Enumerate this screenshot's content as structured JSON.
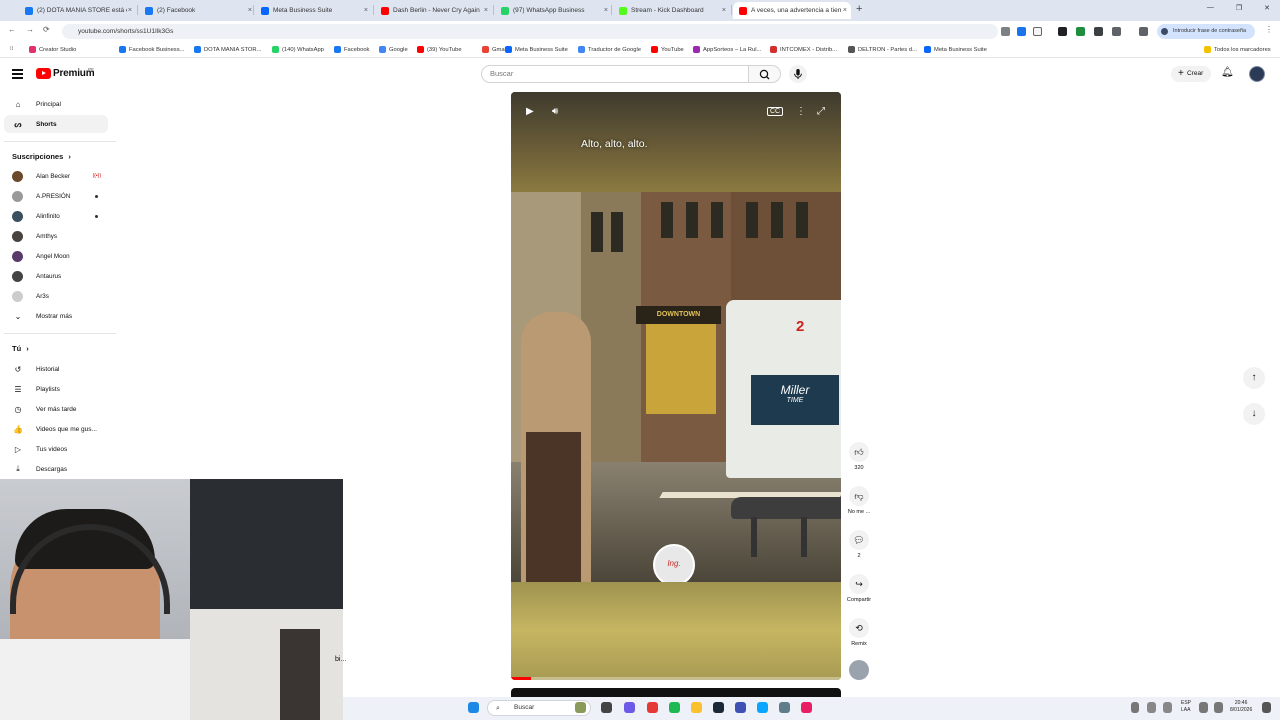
{
  "browser": {
    "tabs": [
      {
        "title": "(2) DOTA MANIA STORE está e",
        "color": "#1877f2"
      },
      {
        "title": "(2) Facebook",
        "color": "#1877f2"
      },
      {
        "title": "Meta Business Suite",
        "color": "#0866ff"
      },
      {
        "title": "Dash Berlin - Never Cry Again",
        "color": "#ff0000"
      },
      {
        "title": "(97) WhatsApp Business",
        "color": "#25d366"
      },
      {
        "title": "Stream - Kick Dashboard",
        "color": "#53fc18"
      },
      {
        "title": "A veces, una advertencia a tiem",
        "color": "#ff0000"
      }
    ],
    "url": "youtube.com/shorts/ss1U1Ilk3Gs",
    "password_pill": "Introducir frase de contraseña",
    "bookmarks": [
      {
        "label": "Creator Studio",
        "color": "#e1306c"
      },
      {
        "label": "Facebook Business...",
        "color": "#1877f2"
      },
      {
        "label": "DOTA MANIA STOR...",
        "color": "#1877f2"
      },
      {
        "label": "(140) WhatsApp",
        "color": "#25d366"
      },
      {
        "label": "Facebook",
        "color": "#1877f2"
      },
      {
        "label": "Google",
        "color": "#4285f4"
      },
      {
        "label": "(39) YouTube",
        "color": "#ff0000"
      },
      {
        "label": "Gmail",
        "color": "#ea4335"
      },
      {
        "label": "Meta Business Suite",
        "color": "#0866ff"
      },
      {
        "label": "Traductor de Google",
        "color": "#4285f4"
      },
      {
        "label": "YouTube",
        "color": "#ff0000"
      },
      {
        "label": "AppSorteos – La Rul...",
        "color": "#9c27b0"
      },
      {
        "label": "INTCOMEX - Distrib...",
        "color": "#d32f2f"
      },
      {
        "label": "DELTRON - Partes d...",
        "color": "#555555"
      },
      {
        "label": "Meta Business Suite",
        "color": "#0866ff"
      }
    ],
    "all_bookmarks": "Todos los marcadores"
  },
  "header": {
    "logo_word": "Premium",
    "logo_country": "PE",
    "search_placeholder": "Buscar",
    "create_label": "Crear"
  },
  "sidebar": {
    "main": [
      {
        "label": "Principal",
        "icon": "home-icon",
        "glyph": "⌂"
      },
      {
        "label": "Shorts",
        "icon": "shorts-icon",
        "glyph": "ᔕ"
      }
    ],
    "subs_header": "Suscripciones",
    "subscriptions": [
      {
        "name": "Alan Becker",
        "color": "#6b4a2b",
        "indicator": "live"
      },
      {
        "name": "A.PRESIÓN",
        "color": "#9a9a9a",
        "indicator": "dot"
      },
      {
        "name": "Alinfinito",
        "color": "#3a5060",
        "indicator": "dot"
      },
      {
        "name": "Amthys",
        "color": "#4a4440",
        "indicator": ""
      },
      {
        "name": "Angel Moon",
        "color": "#5a3a6a",
        "indicator": ""
      },
      {
        "name": "Antaurus",
        "color": "#444444",
        "indicator": ""
      },
      {
        "name": "Ar3s",
        "color": "#cccccc",
        "indicator": ""
      }
    ],
    "show_more": "Mostrar más",
    "you_header": "Tú",
    "you_items": [
      {
        "label": "Historial",
        "icon": "history-icon",
        "glyph": "↺"
      },
      {
        "label": "Playlists",
        "icon": "playlists-icon",
        "glyph": "☰"
      },
      {
        "label": "Ver más tarde",
        "icon": "watch-later-icon",
        "glyph": "◷"
      },
      {
        "label": "Videos que me gus...",
        "icon": "liked-icon",
        "glyph": "👍"
      },
      {
        "label": "Tus videos",
        "icon": "your-videos-icon",
        "glyph": "▷"
      },
      {
        "label": "Descargas",
        "icon": "downloads-icon",
        "glyph": "⤓"
      }
    ]
  },
  "video": {
    "caption": "Alto, alto, alto.",
    "progress": 0.06,
    "bus_number": "2",
    "bus_ad_line1": "Miller",
    "bus_ad_line2": "TIME",
    "storefront": "DOWNTOWN",
    "watermark": "Ing."
  },
  "actions": {
    "like_count": "320",
    "dislike_label": "No me ...",
    "comment_count": "2",
    "share_label": "Compartir",
    "remix_label": "Remix"
  },
  "webcam": {
    "overlay_text": "bi..."
  },
  "taskbar": {
    "search_label": "Buscar",
    "lang_line1": "ESP",
    "lang_line2": "LAA",
    "time": "20:46",
    "date": "8/01/2026"
  }
}
